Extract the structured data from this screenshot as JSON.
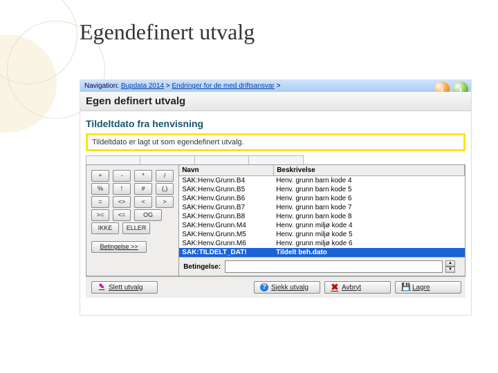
{
  "slide_title": "Egendefinert utvalg",
  "navigation": {
    "label": "Navigation:",
    "crumb1": "Bupdata 2014",
    "sep": ">",
    "crumb2": "Endringer for de med driftsansvar",
    "tail": ">"
  },
  "page_header": "Egen definert utvalg",
  "section_title": "Tildeltdato fra henvisning",
  "highlight_message": "Tildeltdato er lagt ut som egendefinert utvalg.",
  "keypad": {
    "r1": [
      "+",
      "-",
      "*",
      "/"
    ],
    "r2": [
      "%",
      "!",
      "#",
      "(,)"
    ],
    "r3": [
      "=",
      "<>",
      "<",
      ">"
    ],
    "r4": [
      ">=",
      "<=",
      "OG"
    ],
    "r5": [
      "IKKE",
      "ELLER"
    ],
    "cond_btn": "Betingelse >>"
  },
  "list": {
    "col1": "Navn",
    "col2": "Beskrivelse",
    "rows": [
      {
        "n": "SAK:Henv.Grunn.B4",
        "b": "Henv. grunn barn kode 4"
      },
      {
        "n": "SAK:Henv.Grunn.B5",
        "b": "Henv. grunn barn kode 5"
      },
      {
        "n": "SAK:Henv.Grunn.B6",
        "b": "Henv. grunn barn kode 6"
      },
      {
        "n": "SAK:Henv.Grunn.B7",
        "b": "Henv. grunn barn kode 7"
      },
      {
        "n": "SAK:Henv.Grunn.B8",
        "b": "Henv. grunn barn kode 8"
      },
      {
        "n": "SAK:Henv.Grunn.M4",
        "b": "Henv. grunn miljø kode 4"
      },
      {
        "n": "SAK:Henv.Grunn.M5",
        "b": "Henv. grunn miljø kode 5"
      },
      {
        "n": "SAK:Henv.Grunn.M6",
        "b": "Henv. grunn miljø kode 6"
      },
      {
        "n": "SAK:TILDELT_DAT!",
        "b": "Tildelt beh.dato",
        "sel": true
      }
    ]
  },
  "condition_label": "Betingelse:",
  "buttons": {
    "delete": "Slett utvalg",
    "check": "Sjekk utvalg",
    "cancel": "Avbryt",
    "save": "Lagre"
  }
}
